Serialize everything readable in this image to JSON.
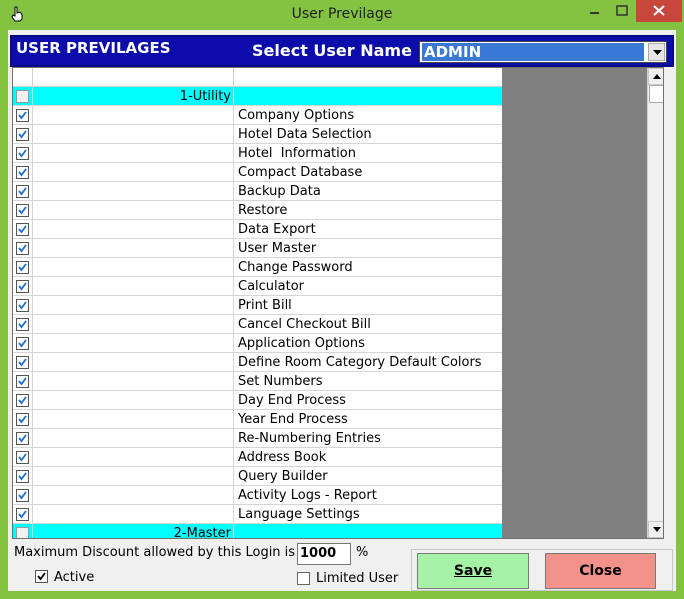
{
  "window": {
    "title": "User Previlage"
  },
  "header": {
    "title": "USER PREVILAGES",
    "select_label": "Select User Name",
    "selected_user": "ADMIN"
  },
  "grid": {
    "rows": [
      {
        "type": "group",
        "group": "1-Utility",
        "name": "",
        "checked": false
      },
      {
        "type": "item",
        "group": "",
        "name": "Company Options",
        "checked": true
      },
      {
        "type": "item",
        "group": "",
        "name": "Hotel Data Selection",
        "checked": true
      },
      {
        "type": "item",
        "group": "",
        "name": "Hotel  Information",
        "checked": true
      },
      {
        "type": "item",
        "group": "",
        "name": "Compact Database",
        "checked": true
      },
      {
        "type": "item",
        "group": "",
        "name": "Backup Data",
        "checked": true
      },
      {
        "type": "item",
        "group": "",
        "name": "Restore",
        "checked": true
      },
      {
        "type": "item",
        "group": "",
        "name": "Data Export",
        "checked": true
      },
      {
        "type": "item",
        "group": "",
        "name": "User Master",
        "checked": true
      },
      {
        "type": "item",
        "group": "",
        "name": "Change Password",
        "checked": true
      },
      {
        "type": "item",
        "group": "",
        "name": "Calculator",
        "checked": true
      },
      {
        "type": "item",
        "group": "",
        "name": "Print Bill",
        "checked": true
      },
      {
        "type": "item",
        "group": "",
        "name": "Cancel Checkout Bill",
        "checked": true
      },
      {
        "type": "item",
        "group": "",
        "name": "Application Options",
        "checked": true
      },
      {
        "type": "item",
        "group": "",
        "name": "Define Room Category Default Colors",
        "checked": true
      },
      {
        "type": "item",
        "group": "",
        "name": "Set Numbers",
        "checked": true
      },
      {
        "type": "item",
        "group": "",
        "name": "Day End Process",
        "checked": true
      },
      {
        "type": "item",
        "group": "",
        "name": "Year End Process",
        "checked": true
      },
      {
        "type": "item",
        "group": "",
        "name": "Re-Numbering Entries",
        "checked": true
      },
      {
        "type": "item",
        "group": "",
        "name": "Address Book",
        "checked": true
      },
      {
        "type": "item",
        "group": "",
        "name": "Query Builder",
        "checked": true
      },
      {
        "type": "item",
        "group": "",
        "name": "Activity Logs - Report",
        "checked": true
      },
      {
        "type": "item",
        "group": "",
        "name": "Language Settings",
        "checked": true
      },
      {
        "type": "group",
        "group": "2-Master",
        "name": "",
        "checked": false
      }
    ]
  },
  "footer": {
    "discount_label": "Maximum Discount allowed by this Login is",
    "discount_value": "1000",
    "percent_sign": "%",
    "active_label": "Active",
    "active_checked": true,
    "limited_label": "Limited User",
    "limited_checked": false,
    "save_label": "Save",
    "close_label": "Close"
  },
  "colors": {
    "frame": "#84c341",
    "header_band": "#0c0caa",
    "group_row": "#00ffff",
    "save_button": "#a6f2a6",
    "close_button": "#f2928a",
    "close_window": "#c7483b"
  }
}
